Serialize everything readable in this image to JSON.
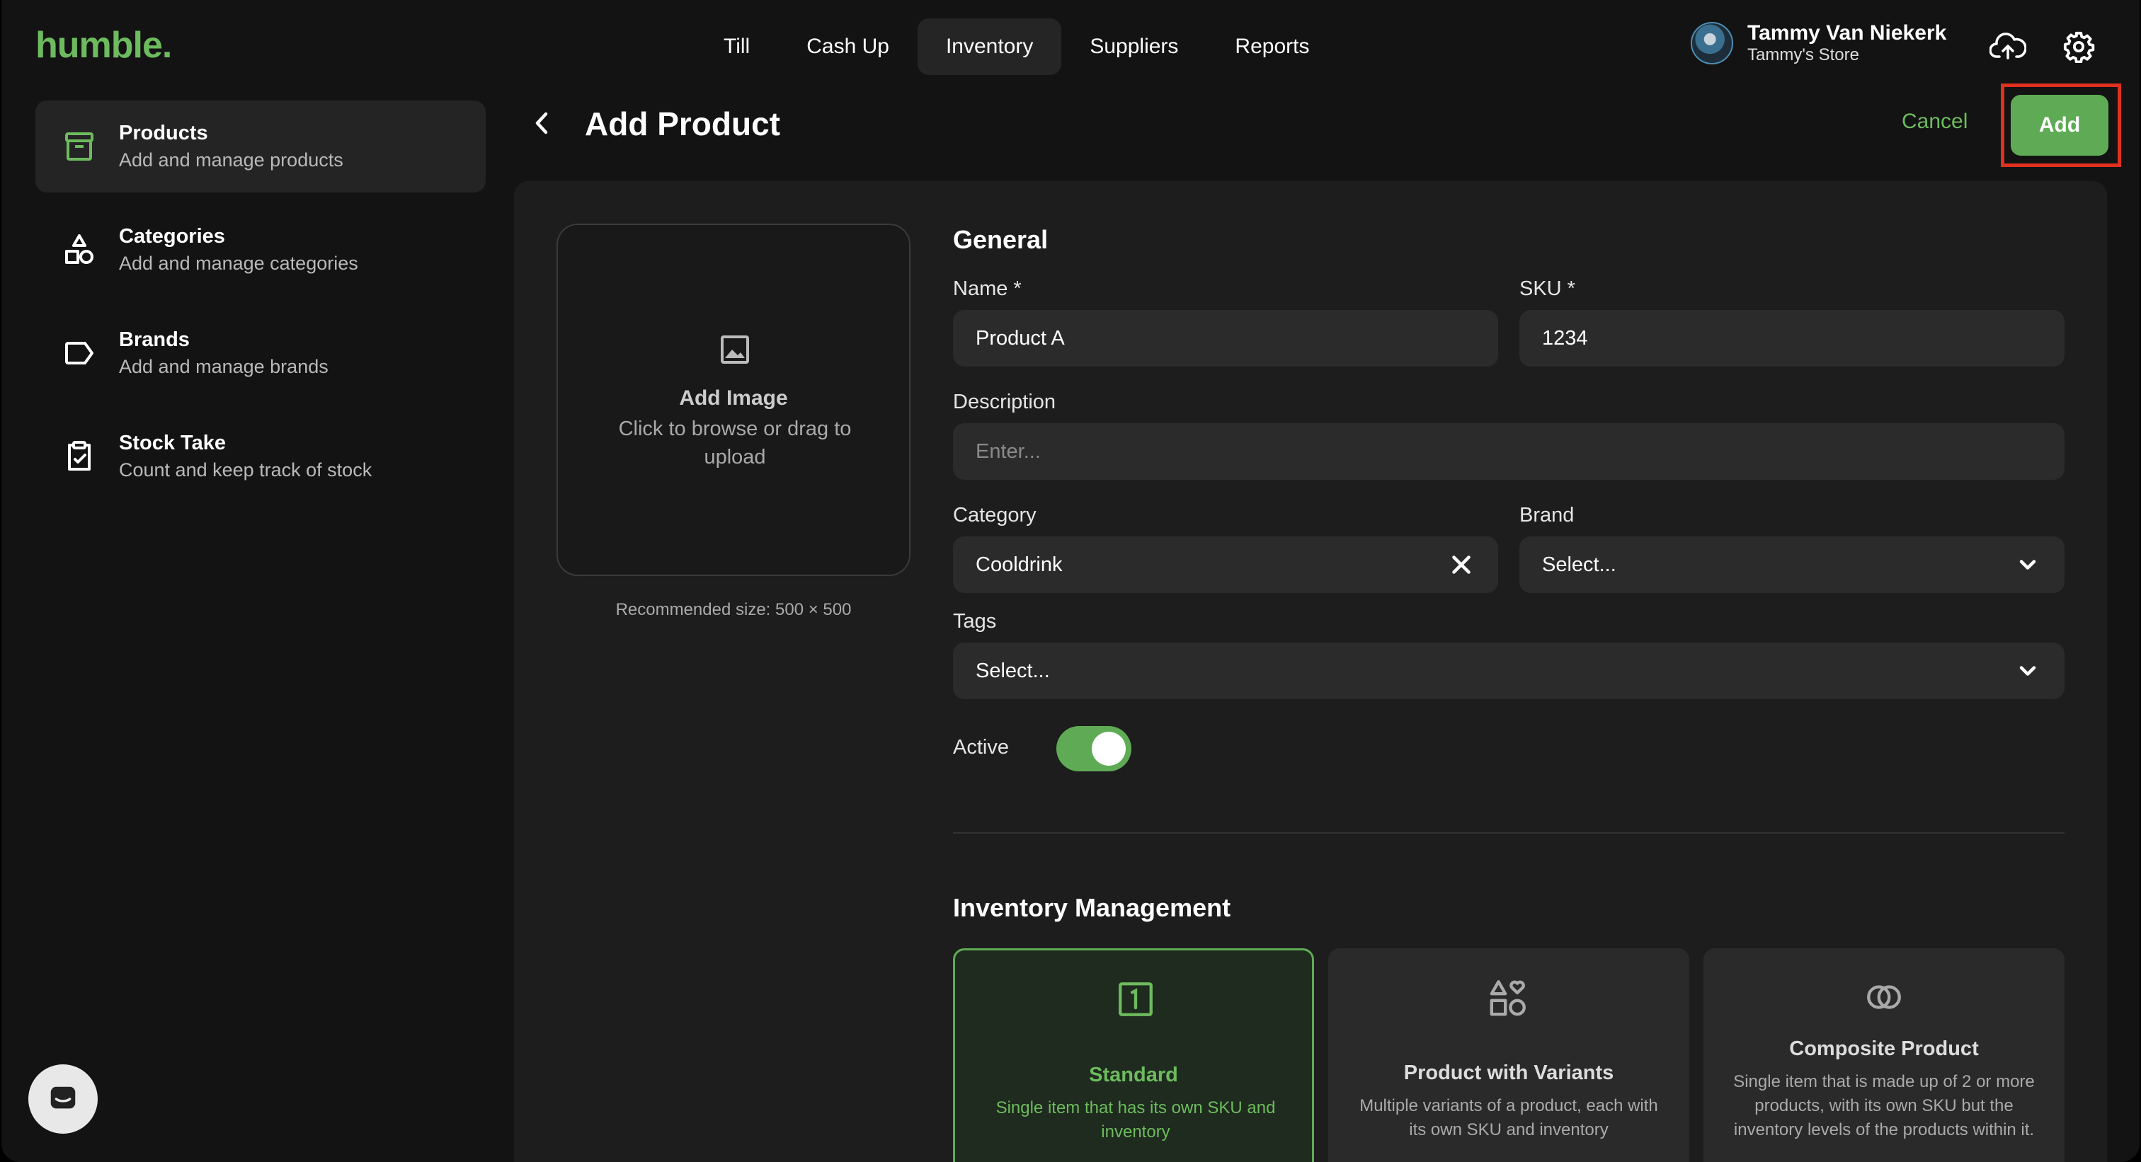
{
  "app": {
    "logo": "humble."
  },
  "nav": {
    "items": [
      {
        "label": "Till"
      },
      {
        "label": "Cash Up"
      },
      {
        "label": "Inventory"
      },
      {
        "label": "Suppliers"
      },
      {
        "label": "Reports"
      }
    ],
    "active": "Inventory"
  },
  "user": {
    "name": "Tammy Van Niekerk",
    "store": "Tammy's Store"
  },
  "sidebar": {
    "items": [
      {
        "title": "Products",
        "subtitle": "Add and manage products",
        "icon": "archive-box-icon"
      },
      {
        "title": "Categories",
        "subtitle": "Add and manage categories",
        "icon": "shapes-icon"
      },
      {
        "title": "Brands",
        "subtitle": "Add and manage brands",
        "icon": "tag-icon"
      },
      {
        "title": "Stock Take",
        "subtitle": "Count and keep track of stock",
        "icon": "clipboard-check-icon"
      }
    ]
  },
  "header": {
    "title": "Add Product",
    "cancel_label": "Cancel",
    "add_label": "Add"
  },
  "image_upload": {
    "title": "Add Image",
    "subtitle": "Click to browse or drag to upload",
    "recommended": "Recommended size: 500 × 500"
  },
  "general": {
    "title": "General",
    "name_label": "Name *",
    "name_value": "Product A",
    "sku_label": "SKU *",
    "sku_value": "1234",
    "description_label": "Description",
    "description_placeholder": "Enter...",
    "category_label": "Category",
    "category_value": "Cooldrink",
    "brand_label": "Brand",
    "brand_placeholder": "Select...",
    "tags_label": "Tags",
    "tags_placeholder": "Select...",
    "active_label": "Active",
    "active_on": true
  },
  "inventory": {
    "title": "Inventory Management",
    "options": [
      {
        "title": "Standard",
        "desc": "Single item that has its own SKU and inventory",
        "selected": true
      },
      {
        "title": "Product with Variants",
        "desc": "Multiple variants of a product, each with its own SKU and inventory",
        "selected": false
      },
      {
        "title": "Composite Product",
        "desc": "Single item that is made up of 2 or more products, with its own SKU but the inventory levels of the products within it.",
        "selected": false
      }
    ]
  },
  "colors": {
    "accent": "#5fab55",
    "highlight": "#e0301e"
  }
}
